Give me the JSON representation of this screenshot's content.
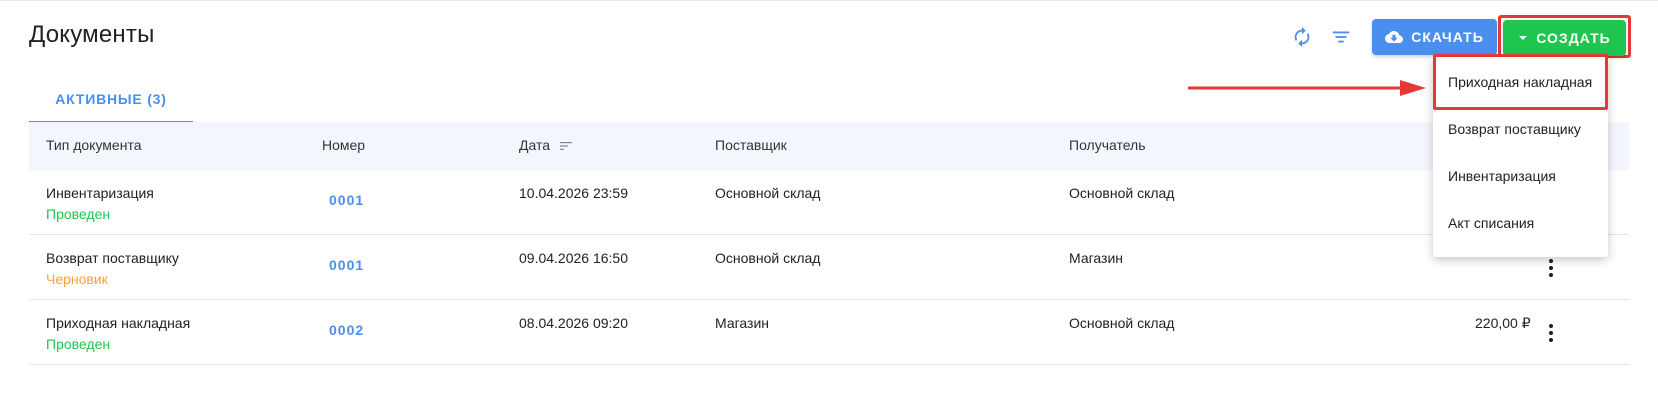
{
  "header": {
    "title": "Документы",
    "download_label": "СКАЧАТЬ",
    "create_label": "СОЗДАТЬ"
  },
  "tabs": [
    {
      "label": "АКТИВНЫЕ (3)",
      "active": true
    }
  ],
  "table": {
    "columns": [
      "Тип документа",
      "Номер",
      "Дата",
      "Поставщик",
      "Получатель"
    ],
    "rows": [
      {
        "type": "Инвентаризация",
        "status": "Проведен",
        "status_color": "#1ec64f",
        "number": "0001",
        "date": "10.04.2026 23:59",
        "supplier": "Основной склад",
        "recipient": "Основной склад",
        "sum": ""
      },
      {
        "type": "Возврат поставщику",
        "status": "Черновик",
        "status_color": "#f0a53a",
        "number": "0001",
        "date": "09.04.2026 16:50",
        "supplier": "Основной склад",
        "recipient": "Магазин",
        "sum": ""
      },
      {
        "type": "Приходная накладная",
        "status": "Проведен",
        "status_color": "#1ec64f",
        "number": "0002",
        "date": "08.04.2026 09:20",
        "supplier": "Магазин",
        "recipient": "Основной склад",
        "sum": "220,00 ₽"
      }
    ]
  },
  "create_menu": {
    "items": [
      "Приходная накладная",
      "Возврат поставщику",
      "Инвентаризация",
      "Акт списания"
    ],
    "highlighted_index": 0
  },
  "colors": {
    "accent_blue": "#4a8ff0",
    "create_green": "#1ec64f",
    "highlight_red": "#e53935",
    "header_bg": "#f3f7fd"
  },
  "icons": {
    "refresh": "refresh-icon",
    "filter": "filter-icon",
    "download": "cloud-download-icon",
    "create": "caret-down-icon",
    "sort": "sort-icon",
    "row_menu": "more-vertical-icon"
  }
}
